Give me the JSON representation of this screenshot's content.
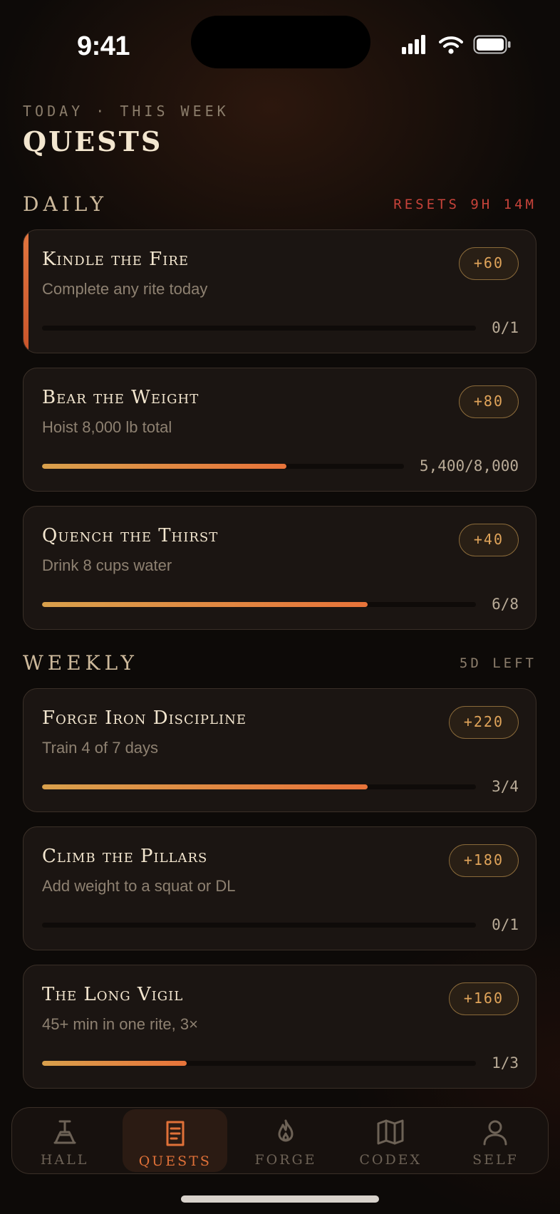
{
  "status": {
    "time": "9:41"
  },
  "header": {
    "eyebrow": "TODAY · THIS WEEK",
    "title": "QUESTS"
  },
  "daily": {
    "title": "DAILY",
    "meta": "RESETS 9H 14M",
    "quests": [
      {
        "title": "Kindle the Fire",
        "subtitle": "Complete any rite today",
        "reward": "+60",
        "count": "0/1",
        "progress": 0,
        "active": true
      },
      {
        "title": "Bear the Weight",
        "subtitle": "Hoist 8,000 lb total",
        "reward": "+80",
        "count": "5,400/8,000",
        "progress": 0.675
      },
      {
        "title": "Quench the Thirst",
        "subtitle": "Drink 8 cups water",
        "reward": "+40",
        "count": "6/8",
        "progress": 0.75
      }
    ]
  },
  "weekly": {
    "title": "WEEKLY",
    "meta": "5D LEFT",
    "quests": [
      {
        "title": "Forge Iron Discipline",
        "subtitle": "Train 4 of 7 days",
        "reward": "+220",
        "count": "3/4",
        "progress": 0.75
      },
      {
        "title": "Climb the Pillars",
        "subtitle": "Add weight to a squat or DL",
        "reward": "+180",
        "count": "0/1",
        "progress": 0
      },
      {
        "title": "The Long Vigil",
        "subtitle": "45+ min in one rite, 3×",
        "reward": "+160",
        "count": "1/3",
        "progress": 0.333
      }
    ]
  },
  "tabs": [
    {
      "label": "HALL",
      "icon": "hall-icon"
    },
    {
      "label": "QUESTS",
      "icon": "quests-icon",
      "selected": true
    },
    {
      "label": "FORGE",
      "icon": "flame-icon"
    },
    {
      "label": "CODEX",
      "icon": "map-icon"
    },
    {
      "label": "SELF",
      "icon": "person-icon"
    }
  ],
  "colors": {
    "accent": "#e07138",
    "gold": "#e0a45a",
    "alert": "#c7433a"
  }
}
